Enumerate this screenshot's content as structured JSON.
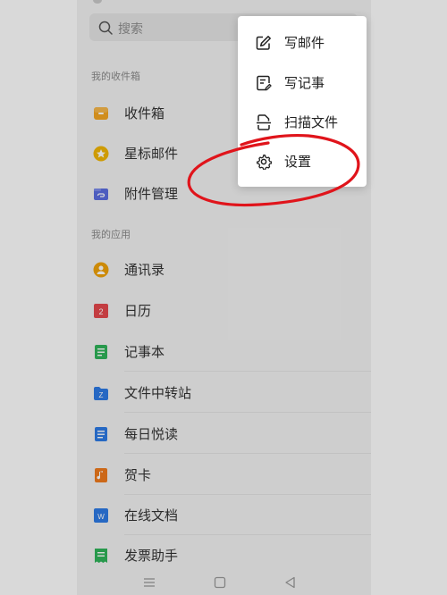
{
  "search": {
    "placeholder": "搜索"
  },
  "sections": {
    "mailbox": "我的收件箱",
    "apps": "我的应用"
  },
  "mailbox_items": [
    {
      "label": "收件箱",
      "icon": "inbox-icon",
      "color": "#f5a623"
    },
    {
      "label": "星标邮件",
      "icon": "star-icon",
      "color": "#f2b705"
    },
    {
      "label": "附件管理",
      "icon": "attachment-icon",
      "color": "#5b6ee1"
    }
  ],
  "app_items": [
    {
      "label": "通讯录",
      "icon": "contacts-icon",
      "color": "#f0a30a"
    },
    {
      "label": "日历",
      "icon": "calendar-icon",
      "color": "#e5484d",
      "badge": "2"
    },
    {
      "label": "记事本",
      "icon": "notepad-icon",
      "color": "#2fb45a"
    },
    {
      "label": "文件中转站",
      "icon": "file-transfer-icon",
      "color": "#2d7be5",
      "badge": "Z"
    },
    {
      "label": "每日悦读",
      "icon": "daily-reading-icon",
      "color": "#2d7be5"
    },
    {
      "label": "贺卡",
      "icon": "greeting-card-icon",
      "color": "#f07b1d"
    },
    {
      "label": "在线文档",
      "icon": "online-doc-icon",
      "color": "#2d7be5",
      "badge": "W"
    },
    {
      "label": "发票助手",
      "icon": "invoice-icon",
      "color": "#2fb45a"
    }
  ],
  "menu": {
    "compose_mail": "写邮件",
    "write_note": "写记事",
    "scan_file": "扫描文件",
    "settings": "设置"
  },
  "annotation_color": "#e0141b"
}
